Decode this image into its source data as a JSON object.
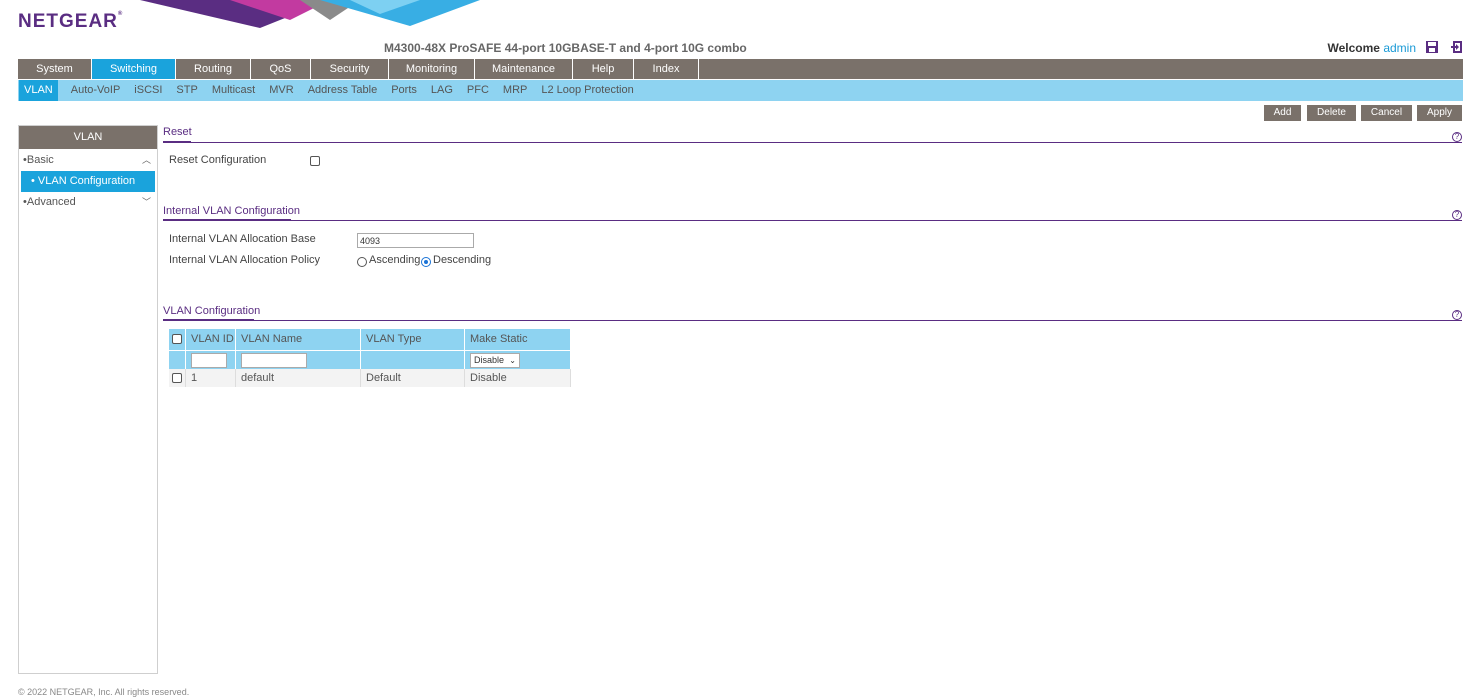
{
  "brand": {
    "logo": "NETGEAR",
    "reg": "®"
  },
  "header": {
    "device_title": "M4300-48X ProSAFE 44-port 10GBASE-T and 4-port 10G combo",
    "welcome_label": "Welcome",
    "user": "admin"
  },
  "main_nav": [
    "System",
    "Switching",
    "Routing",
    "QoS",
    "Security",
    "Monitoring",
    "Maintenance",
    "Help",
    "Index"
  ],
  "sub_nav": [
    "VLAN",
    "Auto-VoIP",
    "iSCSI",
    "STP",
    "Multicast",
    "MVR",
    "Address Table",
    "Ports",
    "LAG",
    "PFC",
    "MRP",
    "L2 Loop Protection"
  ],
  "actions": {
    "add": "Add",
    "delete": "Delete",
    "cancel": "Cancel",
    "apply": "Apply"
  },
  "sidebar": {
    "title": "VLAN",
    "basic": "Basic",
    "vlan_configuration": "VLAN Configuration",
    "advanced": "Advanced"
  },
  "reset": {
    "title": "Reset",
    "reset_configuration_label": "Reset Configuration"
  },
  "internal_vlan": {
    "title": "Internal VLAN Configuration",
    "allocation_base_label": "Internal VLAN Allocation Base",
    "allocation_base_value": "4093",
    "allocation_policy_label": "Internal VLAN Allocation Policy",
    "ascending": "Ascending",
    "descending": "Descending"
  },
  "vlan_config": {
    "title": "VLAN Configuration",
    "columns": [
      "VLAN ID",
      "VLAN Name",
      "VLAN Type",
      "Make Static"
    ],
    "filter_make_static": "Disable",
    "rows": [
      {
        "vlan_id": "1",
        "vlan_name": "default",
        "vlan_type": "Default",
        "make_static": "Disable"
      }
    ]
  },
  "footer": "© 2022 NETGEAR, Inc. All rights reserved."
}
